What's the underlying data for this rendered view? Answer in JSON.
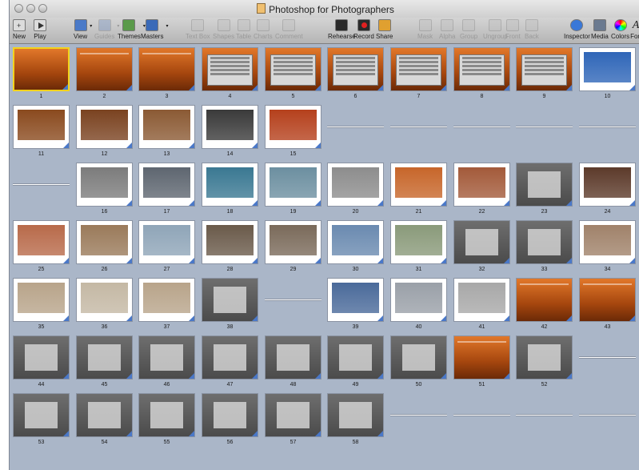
{
  "window": {
    "title": "Photoshop for Photographers"
  },
  "toolbar": [
    {
      "label": "New",
      "icon": "new-slide-icon",
      "enabled": true
    },
    {
      "label": "Play",
      "icon": "play-icon",
      "enabled": true
    },
    {
      "label": "View",
      "icon": "view-icon",
      "enabled": true
    },
    {
      "label": "Guides",
      "icon": "guides-icon",
      "enabled": false
    },
    {
      "label": "Themes",
      "icon": "themes-icon",
      "enabled": true
    },
    {
      "label": "Masters",
      "icon": "masters-icon",
      "enabled": true
    },
    {
      "label": "Text Box",
      "icon": "text-box-icon",
      "enabled": false
    },
    {
      "label": "Shapes",
      "icon": "shapes-icon",
      "enabled": false
    },
    {
      "label": "Table",
      "icon": "table-icon",
      "enabled": false
    },
    {
      "label": "Charts",
      "icon": "charts-icon",
      "enabled": false
    },
    {
      "label": "Comment",
      "icon": "comment-icon",
      "enabled": false
    },
    {
      "label": "Rehearse",
      "icon": "rehearse-icon",
      "enabled": true
    },
    {
      "label": "Record",
      "icon": "record-icon",
      "enabled": true
    },
    {
      "label": "Share",
      "icon": "share-icon",
      "enabled": true
    },
    {
      "label": "Mask",
      "icon": "mask-icon",
      "enabled": false
    },
    {
      "label": "Alpha",
      "icon": "alpha-icon",
      "enabled": false
    },
    {
      "label": "Group",
      "icon": "group-icon",
      "enabled": false
    },
    {
      "label": "Ungroup",
      "icon": "ungroup-icon",
      "enabled": false
    },
    {
      "label": "Front",
      "icon": "front-icon",
      "enabled": false
    },
    {
      "label": "Back",
      "icon": "back-icon",
      "enabled": false
    },
    {
      "label": "Inspector",
      "icon": "inspector-icon",
      "enabled": true
    },
    {
      "label": "Media",
      "icon": "media-icon",
      "enabled": true
    },
    {
      "label": "Colors",
      "icon": "colors-icon",
      "enabled": true
    },
    {
      "label": "Fon",
      "icon": "fonts-icon",
      "enabled": true
    }
  ],
  "colors": {
    "selection": "#f2d21c",
    "canvas": "#aab6c8",
    "accent_orange": "#d2691e"
  },
  "slide_title_1": "Photoshop For Photographers",
  "slides": [
    {
      "n": "1",
      "kind": "orange",
      "selected": true
    },
    {
      "n": "2",
      "kind": "orange"
    },
    {
      "n": "3",
      "kind": "orange"
    },
    {
      "n": "4",
      "kind": "orange-panel"
    },
    {
      "n": "5",
      "kind": "orange-panel"
    },
    {
      "n": "6",
      "kind": "orange-panel"
    },
    {
      "n": "7",
      "kind": "orange-panel"
    },
    {
      "n": "8",
      "kind": "orange-panel"
    },
    {
      "n": "9",
      "kind": "orange-panel"
    },
    {
      "n": "10",
      "kind": "photo",
      "tone": "#2f66b8"
    },
    {
      "n": "11",
      "kind": "photo",
      "tone": "#8a4a1e"
    },
    {
      "n": "12",
      "kind": "photo",
      "tone": "#7a4220"
    },
    {
      "n": "13",
      "kind": "photo",
      "tone": "#8b5a34"
    },
    {
      "n": "14",
      "kind": "photo",
      "tone": "#3a3a3a"
    },
    {
      "n": "15",
      "kind": "photo",
      "tone": "#b5401c"
    },
    {
      "n": "16",
      "kind": "photo",
      "tone": "#7c7c7c"
    },
    {
      "n": "17",
      "kind": "photo",
      "tone": "#5e6670"
    },
    {
      "n": "18",
      "kind": "photo",
      "tone": "#3a7892"
    },
    {
      "n": "19",
      "kind": "photo",
      "tone": "#6c8fa0"
    },
    {
      "n": "20",
      "kind": "photo",
      "tone": "#8d8d8d"
    },
    {
      "n": "21",
      "kind": "photo",
      "tone": "#c7662a"
    },
    {
      "n": "22",
      "kind": "photo",
      "tone": "#a35a3a"
    },
    {
      "n": "23",
      "kind": "gray"
    },
    {
      "n": "24",
      "kind": "photo",
      "tone": "#5c3a2a"
    },
    {
      "n": "25",
      "kind": "photo",
      "tone": "#b86a4a"
    },
    {
      "n": "26",
      "kind": "photo",
      "tone": "#9a7a5a"
    },
    {
      "n": "27",
      "kind": "photo",
      "tone": "#8fa5b8"
    },
    {
      "n": "28",
      "kind": "photo",
      "tone": "#6a5a4a"
    },
    {
      "n": "29",
      "kind": "photo",
      "tone": "#7a6a5a"
    },
    {
      "n": "30",
      "kind": "photo",
      "tone": "#6a8ab0"
    },
    {
      "n": "31",
      "kind": "photo",
      "tone": "#8a9a7a"
    },
    {
      "n": "32",
      "kind": "gray"
    },
    {
      "n": "33",
      "kind": "gray"
    },
    {
      "n": "34",
      "kind": "photo",
      "tone": "#a0826a"
    },
    {
      "n": "35",
      "kind": "photo",
      "tone": "#b8a48a"
    },
    {
      "n": "36",
      "kind": "photo",
      "tone": "#c4b8a4"
    },
    {
      "n": "37",
      "kind": "photo",
      "tone": "#b8a48a"
    },
    {
      "n": "38",
      "kind": "gray"
    },
    {
      "n": "39",
      "kind": "photo",
      "tone": "#4a6a9a"
    },
    {
      "n": "40",
      "kind": "photo",
      "tone": "#9aa0a8"
    },
    {
      "n": "41",
      "kind": "photo",
      "tone": "#a8a8a8"
    },
    {
      "n": "42",
      "kind": "orange"
    },
    {
      "n": "43",
      "kind": "orange"
    },
    {
      "n": "44",
      "kind": "gray"
    },
    {
      "n": "45",
      "kind": "gray"
    },
    {
      "n": "46",
      "kind": "gray"
    },
    {
      "n": "47",
      "kind": "gray"
    },
    {
      "n": "48",
      "kind": "gray"
    },
    {
      "n": "49",
      "kind": "gray"
    },
    {
      "n": "50",
      "kind": "gray"
    },
    {
      "n": "51",
      "kind": "orange"
    },
    {
      "n": "52",
      "kind": "gray"
    },
    {
      "n": "53",
      "kind": "gray"
    },
    {
      "n": "54",
      "kind": "gray"
    },
    {
      "n": "55",
      "kind": "gray"
    },
    {
      "n": "56",
      "kind": "gray"
    },
    {
      "n": "57",
      "kind": "gray"
    },
    {
      "n": "58",
      "kind": "gray"
    }
  ]
}
